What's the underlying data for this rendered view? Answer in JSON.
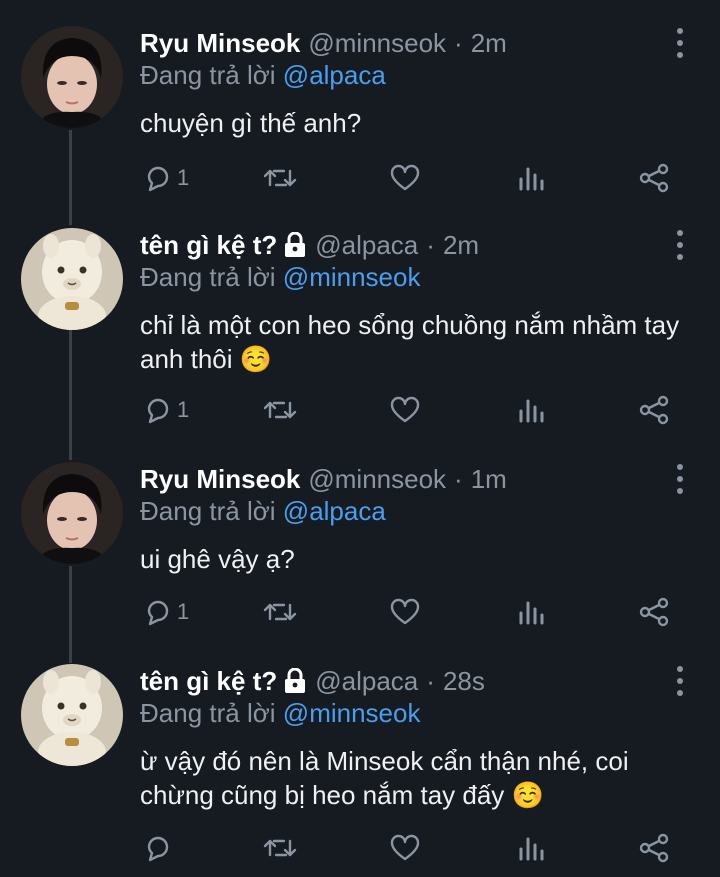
{
  "tweets": [
    {
      "name": "Ryu Minseok",
      "handle": "@minnseok",
      "sep": "·",
      "time": "2m",
      "locked": false,
      "reply_prefix": "Đang trả lời",
      "reply_to": "@alpaca",
      "text": "chuyện gì thế anh?",
      "reply_count": "1",
      "avatar": "person-photo"
    },
    {
      "name": "tên gì kệ t?",
      "handle": "@alpaca",
      "sep": "·",
      "time": "2m",
      "locked": true,
      "reply_prefix": "Đang trả lời",
      "reply_to": "@minnseok",
      "text": "chỉ là một con heo sổng chuồng nắm nhầm tay anh thôi ☺️",
      "reply_count": "1",
      "avatar": "alpaca-photo"
    },
    {
      "name": "Ryu Minseok",
      "handle": "@minnseok",
      "sep": "·",
      "time": "1m",
      "locked": false,
      "reply_prefix": "Đang trả lời",
      "reply_to": "@alpaca",
      "text": "ui ghê vậy ạ?",
      "reply_count": "1",
      "avatar": "person-photo"
    },
    {
      "name": "tên gì kệ t?",
      "handle": "@alpaca",
      "sep": "·",
      "time": "28s",
      "locked": true,
      "reply_prefix": "Đang trả lời",
      "reply_to": "@minnseok",
      "text": "ừ vậy đó nên là Minseok cẩn thận nhé, coi chừng cũng bị heo nắm tay đấy ☺️",
      "reply_count": "",
      "avatar": "alpaca-photo"
    }
  ],
  "icons": {
    "reply": "reply-icon",
    "retweet": "retweet-icon",
    "like": "heart-icon",
    "analytics": "analytics-icon",
    "share": "share-icon",
    "more": "more-vertical-icon",
    "lock": "lock-icon"
  },
  "colors": {
    "background": "#161b22",
    "mention": "#4a9eed",
    "muted": "#8b95a1"
  }
}
